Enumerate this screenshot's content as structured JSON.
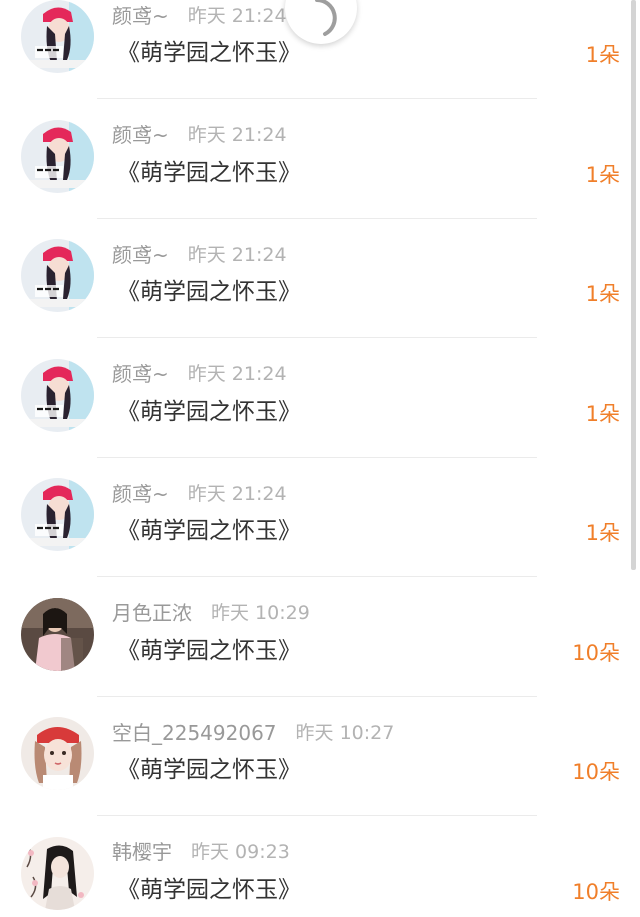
{
  "records": [
    {
      "user": "颜鸢~",
      "time": "昨天 21:24",
      "book": "《萌学园之怀玉》",
      "amount": "1朵",
      "avatar": "anime-girl"
    },
    {
      "user": "颜鸢~",
      "time": "昨天 21:24",
      "book": "《萌学园之怀玉》",
      "amount": "1朵",
      "avatar": "anime-girl"
    },
    {
      "user": "颜鸢~",
      "time": "昨天 21:24",
      "book": "《萌学园之怀玉》",
      "amount": "1朵",
      "avatar": "anime-girl"
    },
    {
      "user": "颜鸢~",
      "time": "昨天 21:24",
      "book": "《萌学园之怀玉》",
      "amount": "1朵",
      "avatar": "anime-girl"
    },
    {
      "user": "颜鸢~",
      "time": "昨天 21:24",
      "book": "《萌学园之怀玉》",
      "amount": "1朵",
      "avatar": "anime-girl"
    },
    {
      "user": "月色正浓",
      "time": "昨天 10:29",
      "book": "《萌学园之怀玉》",
      "amount": "10朵",
      "avatar": "girl-photo"
    },
    {
      "user": "空白_225492067",
      "time": "昨天 10:27",
      "book": "《萌学园之怀玉》",
      "amount": "10朵",
      "avatar": "girl-red-headband"
    },
    {
      "user": "韩樱宇",
      "time": "昨天 09:23",
      "book": "《萌学园之怀玉》",
      "amount": "10朵",
      "avatar": "girl-blossoms"
    }
  ],
  "colors": {
    "amount": "#f07f2a",
    "username": "#999999",
    "title": "#333333"
  },
  "icons": {
    "spinner": "loading-spinner-icon"
  }
}
